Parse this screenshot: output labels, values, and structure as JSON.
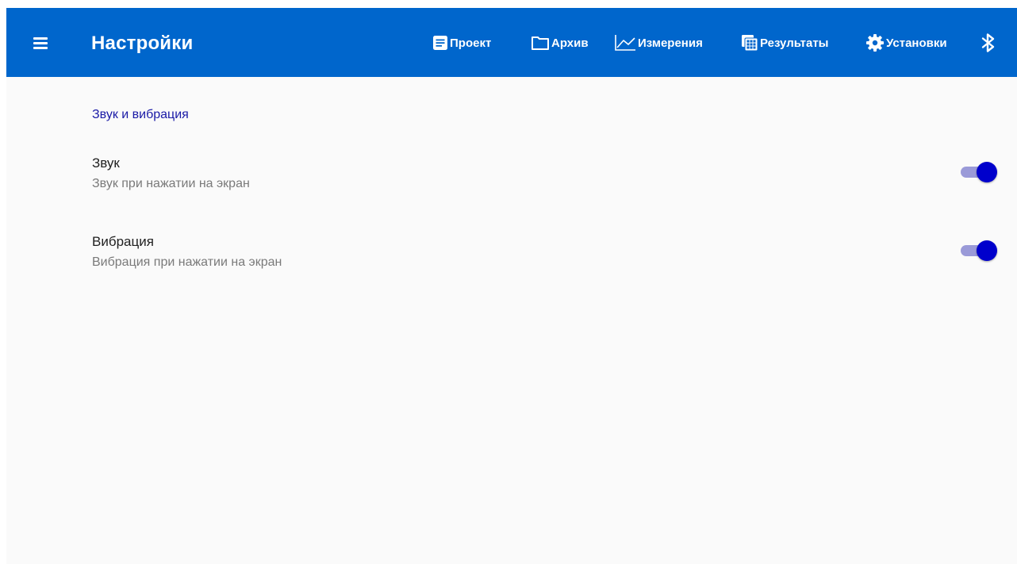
{
  "app": {
    "title": "Настройки",
    "colors": {
      "appbar": "#0066cc",
      "section_header": "#1a1aa6",
      "switch_thumb": "#0000cc",
      "switch_track": "#9a9ad8"
    }
  },
  "nav": {
    "items": [
      {
        "label": "Проект",
        "icon": "document-icon"
      },
      {
        "label": "Архив",
        "icon": "folder-icon"
      },
      {
        "label": "Измерения",
        "icon": "line-chart-icon"
      },
      {
        "label": "Результаты",
        "icon": "calculator-icon"
      },
      {
        "label": "Установки",
        "icon": "gear-icon"
      }
    ],
    "bluetooth_icon": "bluetooth-icon",
    "menu_icon": "hamburger-menu-icon"
  },
  "settings": {
    "section_title": "Звук и вибрация",
    "items": [
      {
        "title": "Звук",
        "subtitle": "Звук при нажатии на экран",
        "enabled": true
      },
      {
        "title": "Вибрация",
        "subtitle": "Вибрация при нажатии на экран",
        "enabled": true
      }
    ]
  }
}
